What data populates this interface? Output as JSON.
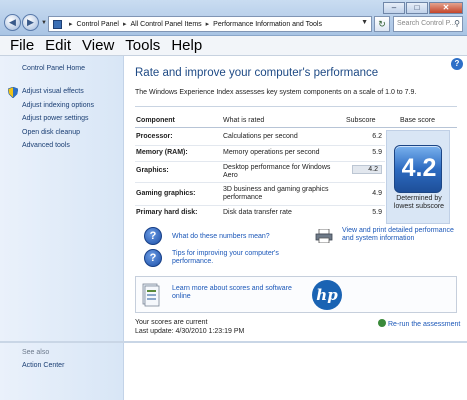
{
  "address_bar": {
    "crumbs": [
      "Control Panel",
      "All Control Panel Items",
      "Performance Information and Tools"
    ],
    "search_placeholder": "Search Control P..."
  },
  "menu": [
    "File",
    "Edit",
    "View",
    "Tools",
    "Help"
  ],
  "sidebar": {
    "home": "Control Panel Home",
    "items": [
      {
        "label": "Adjust visual effects"
      },
      {
        "label": "Adjust indexing options"
      },
      {
        "label": "Adjust power settings"
      },
      {
        "label": "Open disk cleanup"
      },
      {
        "label": "Advanced tools"
      }
    ],
    "see_also": "See also",
    "action_center": "Action Center"
  },
  "main": {
    "heading": "Rate and improve your computer's performance",
    "intro": "The Windows Experience Index assesses key system components on a scale of 1.0 to 7.9.",
    "columns": {
      "component": "Component",
      "rated": "What is rated",
      "subscore": "Subscore",
      "base": "Base score"
    },
    "rows": [
      {
        "component": "Processor:",
        "rated": "Calculations per second",
        "subscore": "6.2"
      },
      {
        "component": "Memory (RAM):",
        "rated": "Memory operations per second",
        "subscore": "5.9"
      },
      {
        "component": "Graphics:",
        "rated": "Desktop performance for Windows Aero",
        "subscore": "4.2"
      },
      {
        "component": "Gaming graphics:",
        "rated": "3D business and gaming graphics performance",
        "subscore": "4.9"
      },
      {
        "component": "Primary hard disk:",
        "rated": "Disk data transfer rate",
        "subscore": "5.9"
      }
    ],
    "base_score": "4.2",
    "base_caption": "Determined by lowest subscore",
    "links": {
      "what_numbers": "What do these numbers mean?",
      "print_details": "View and print detailed performance and system information",
      "tips": "Tips for improving your computer's performance.",
      "learn_more": "Learn more about scores and software online"
    },
    "hp_logo": "hp",
    "status_current": "Your scores are current",
    "last_update": "Last update: 4/30/2010 1:23:19 PM",
    "rerun": "Re-run the assessment"
  }
}
